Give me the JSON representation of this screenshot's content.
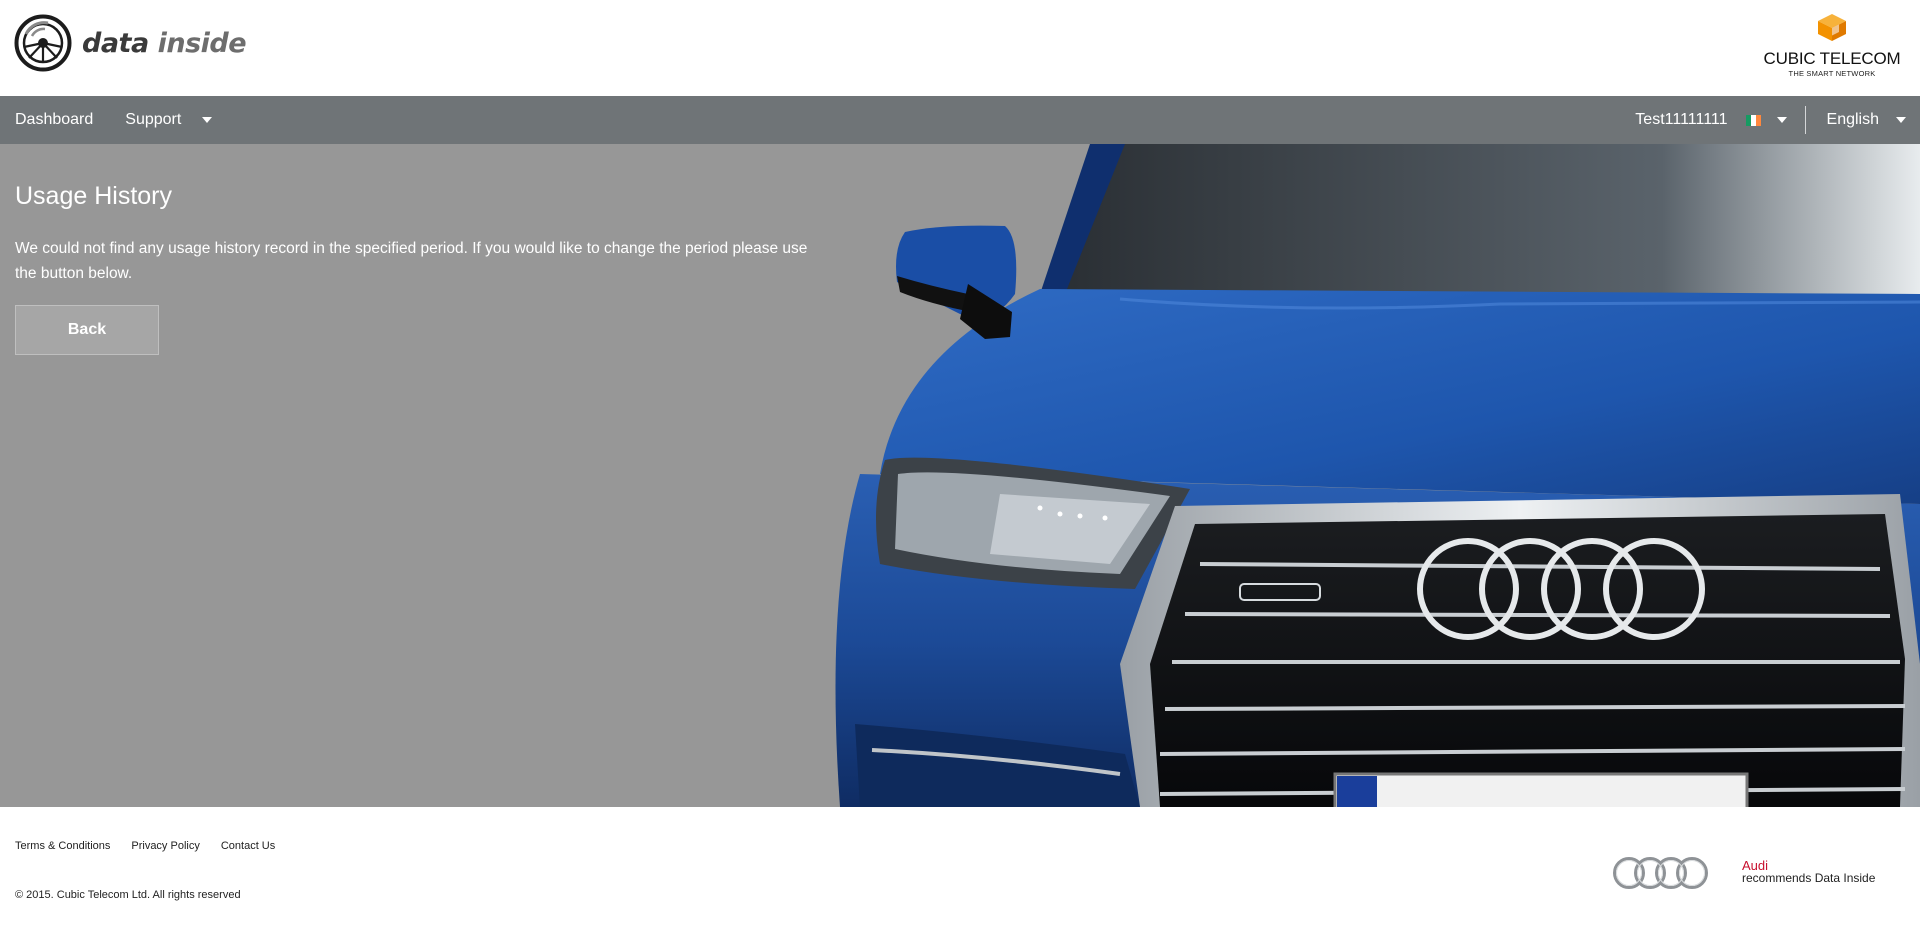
{
  "header": {
    "brand": {
      "name_part1": "data",
      "name_part2": "inside",
      "icon": "steering-wheel-logo-icon"
    },
    "partner": {
      "name": "CUBIC TELECOM",
      "tagline": "THE SMART NETWORK",
      "icon": "cube-logo-icon"
    }
  },
  "nav": {
    "items": [
      {
        "label": "Dashboard"
      },
      {
        "label": "Support",
        "has_dropdown": true
      }
    ],
    "account": {
      "label": "Test11111111",
      "flag_icon": "ireland-flag-icon"
    },
    "language": {
      "label": "English"
    }
  },
  "main": {
    "title": "Usage History",
    "message": "We could not find any usage history record in the specified period. If you would like to change the period please use the button below.",
    "back_button": "Back",
    "hero_image": "blue-audi-q7-front-photo"
  },
  "footer": {
    "links": [
      {
        "label": "Terms & Conditions"
      },
      {
        "label": "Privacy Policy"
      },
      {
        "label": "Contact Us"
      }
    ],
    "copyright": "© 2015. Cubic Telecom Ltd. All rights reserved",
    "audi_brand": "Audi",
    "recommends_text": "recommends Data Inside",
    "rings_icon": "audi-rings-logo-icon"
  },
  "colors": {
    "navbar": "#6f7477",
    "content_bg": "#979797",
    "button_bg": "#a6a6a6",
    "car_blue": "#1f4f9e",
    "audi_red": "#c8102e",
    "cubic_orange": "#f39200"
  }
}
